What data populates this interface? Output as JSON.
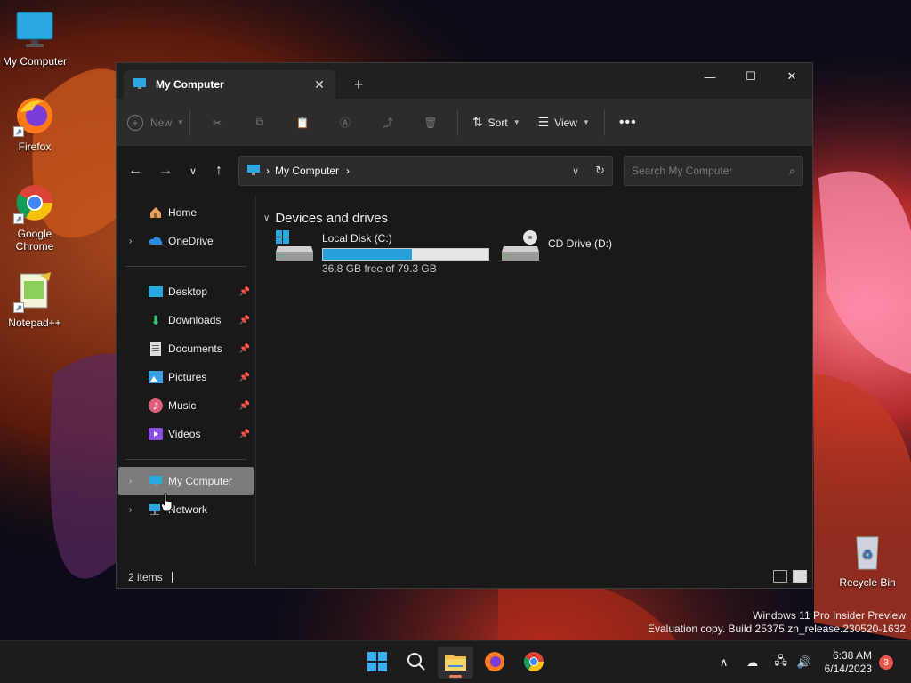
{
  "desktop": {
    "icons": [
      {
        "label": "My Computer",
        "icon": "monitor-icon"
      },
      {
        "label": "Firefox",
        "icon": "firefox-icon"
      },
      {
        "label": "Google Chrome",
        "icon": "chrome-icon"
      },
      {
        "label": "Notepad++",
        "icon": "notepadpp-icon"
      },
      {
        "label": "Recycle Bin",
        "icon": "recycle-bin-icon"
      }
    ],
    "watermark": {
      "line1": "Windows 11 Pro Insider Preview",
      "line2": "Evaluation copy. Build 25375.zn_release.230520-1632"
    }
  },
  "window": {
    "tab_title": "My Computer",
    "toolbar": {
      "new_label": "New",
      "sort_label": "Sort",
      "view_label": "View"
    },
    "address": {
      "crumb": "My Computer"
    },
    "search": {
      "placeholder": "Search My Computer"
    },
    "sidebar": {
      "items": [
        {
          "label": "Home",
          "icon": "home-icon"
        },
        {
          "label": "OneDrive",
          "icon": "cloud-icon"
        },
        {
          "label": "Desktop",
          "icon": "desktop-folder-icon",
          "pinned": true
        },
        {
          "label": "Downloads",
          "icon": "download-icon",
          "pinned": true
        },
        {
          "label": "Documents",
          "icon": "document-icon",
          "pinned": true
        },
        {
          "label": "Pictures",
          "icon": "picture-icon",
          "pinned": true
        },
        {
          "label": "Music",
          "icon": "music-icon",
          "pinned": true
        },
        {
          "label": "Videos",
          "icon": "video-icon",
          "pinned": true
        },
        {
          "label": "My Computer",
          "icon": "monitor-icon",
          "selected": true
        },
        {
          "label": "Network",
          "icon": "network-icon"
        }
      ]
    },
    "content": {
      "group_title": "Devices and drives",
      "drives": [
        {
          "name": "Local Disk (C:)",
          "free_text": "36.8 GB free of 79.3 GB",
          "used_fraction": 0.536
        },
        {
          "name": "CD Drive (D:)"
        }
      ]
    },
    "status": {
      "item_count": "2 items"
    }
  },
  "taskbar": {
    "clock_time": "6:38 AM",
    "clock_date": "6/14/2023",
    "notification_count": "3"
  },
  "colors": {
    "accent": "#26a0da",
    "selection": "#7b7b7b",
    "badge": "#e8584a"
  }
}
